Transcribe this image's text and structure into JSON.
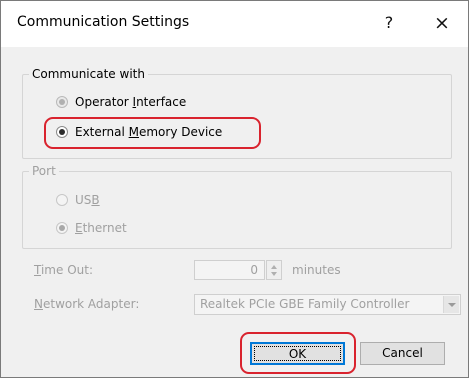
{
  "window": {
    "title": "Communication Settings",
    "help_label": "?",
    "close_label": "×"
  },
  "communicate_with": {
    "legend": "Communicate with",
    "options": [
      {
        "pre": "Operator ",
        "accel": "I",
        "post": "nterface",
        "selected": false
      },
      {
        "pre": "External ",
        "accel": "M",
        "post": "emory Device",
        "selected": true
      }
    ]
  },
  "port": {
    "legend": "Port",
    "options": [
      {
        "pre": "US",
        "accel": "B",
        "post": "",
        "selected": false
      },
      {
        "pre": "",
        "accel": "E",
        "post": "thernet",
        "selected": true
      }
    ]
  },
  "timeout": {
    "label_accel": "T",
    "label_rest": "ime Out:",
    "value": "0",
    "unit": "minutes"
  },
  "network_adapter": {
    "label_accel": "N",
    "label_rest": "etwork Adapter:",
    "value": "Realtek PCIe GBE Family Controller"
  },
  "buttons": {
    "ok": "OK",
    "cancel": "Cancel"
  },
  "highlight_color": "#d9232e"
}
